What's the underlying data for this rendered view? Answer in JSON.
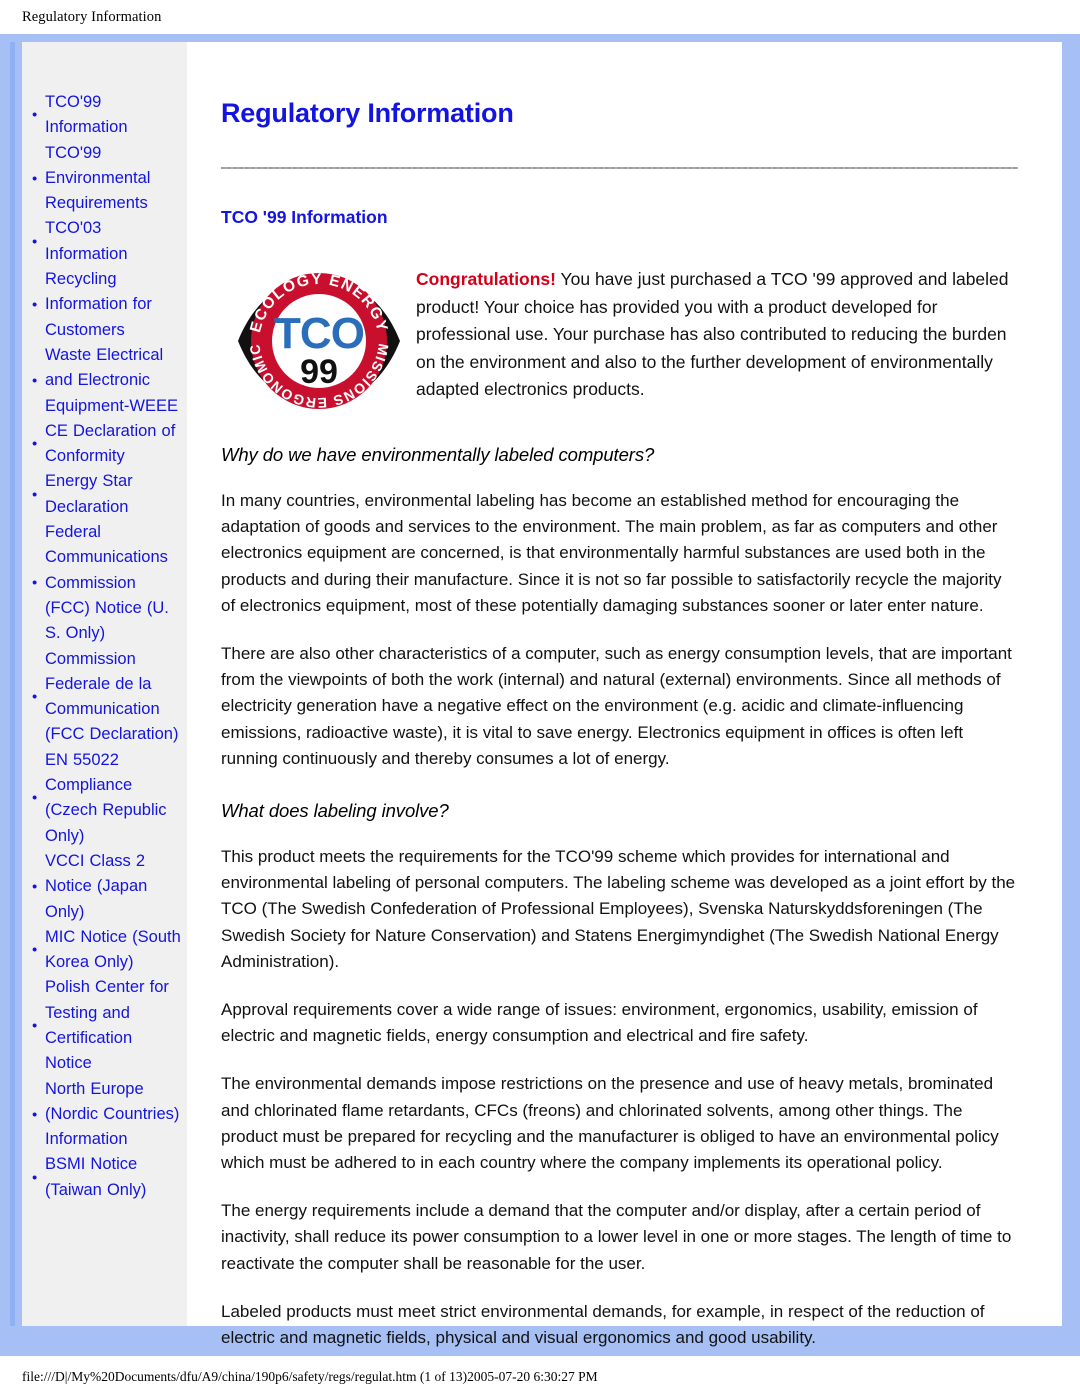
{
  "browser": {
    "header_title": "Regulatory Information",
    "footer_path": "file:///D|/My%20Documents/dfu/A9/china/190p6/safety/regs/regulat.htm (1 of 13)2005-07-20 6:30:27 PM"
  },
  "colors": {
    "frame_blue": "#a6c0f5",
    "link_blue": "#1414e0",
    "sidebar_gray": "#f0f0f0",
    "congrats_red": "#d4001a",
    "logo_red": "#c8102e",
    "logo_tco_blue": "#2a6ebb"
  },
  "sidebar": {
    "items": [
      {
        "label": "TCO'99 Information"
      },
      {
        "label": "TCO'99 Environmental Requirements"
      },
      {
        "label": "TCO'03 Information"
      },
      {
        "label": "Recycling Information for Customers"
      },
      {
        "label": "Waste Electrical and Electronic Equipment-WEEE"
      },
      {
        "label": "CE Declaration of Conformity"
      },
      {
        "label": "Energy Star Declaration"
      },
      {
        "label": "Federal Communications Commission (FCC) Notice (U. S. Only)"
      },
      {
        "label": "Commission Federale de la Communication (FCC Declaration)"
      },
      {
        "label": "EN 55022 Compliance (Czech Republic Only)"
      },
      {
        "label": "VCCI Class 2 Notice (Japan Only)"
      },
      {
        "label": "MIC Notice (South Korea Only)"
      },
      {
        "label": "Polish Center for Testing and Certification Notice"
      },
      {
        "label": "North Europe (Nordic Countries) Information"
      },
      {
        "label": "BSMI Notice (Taiwan Only)"
      }
    ]
  },
  "main": {
    "page_title": "Regulatory Information",
    "section_title": "TCO '99 Information",
    "logo": {
      "name": "tco-99-certification-logo",
      "top_arc_text": "ECOLOGY  ENERGY",
      "bottom_arc_text": "EMISSIONS  ERGONOMICS",
      "center_brand": "TCO",
      "center_year": "99"
    },
    "intro": {
      "lead": "Congratulations!",
      "body": " You have just purchased a TCO '99 approved and labeled product! Your choice has provided you with a product developed for professional use. Your purchase has also contributed to reducing the burden on the environment and also to the further development of environmentally adapted electronics products."
    },
    "heading_why": "Why do we have environmentally labeled computers?",
    "paragraph_1": "In many countries, environmental labeling has become an established method for encouraging the adaptation of goods and services to the environment. The main problem, as far as computers and other electronics equipment are concerned, is that environmentally harmful substances are used both in the products and during their manufacture. Since it is not so far possible to satisfactorily recycle the majority of electronics equipment, most of these potentially damaging substances sooner or later enter nature.",
    "paragraph_2": "There are also other characteristics of a computer, such as energy consumption levels, that are important from the viewpoints of both the work (internal) and natural (external) environments. Since all methods of electricity generation have a negative effect on the environment (e.g. acidic and climate-influencing emissions, radioactive waste), it is vital to save energy. Electronics equipment in offices is often left running continuously and thereby consumes a lot of energy.",
    "heading_what": "What does labeling involve?",
    "paragraph_3": "This product meets the requirements for the TCO'99 scheme which provides for international and environmental labeling of personal computers. The labeling scheme was developed as a joint effort by the TCO (The Swedish Confederation of Professional Employees), Svenska Naturskyddsforeningen (The Swedish Society for Nature Conservation) and Statens Energimyndighet (The Swedish National Energy Administration).",
    "paragraph_4": "Approval requirements cover a wide range of issues: environment, ergonomics, usability, emission of electric and magnetic fields, energy consumption and electrical and fire safety.",
    "paragraph_5": "The environmental demands impose restrictions on the presence and use of heavy metals, brominated and chlorinated flame retardants, CFCs (freons) and chlorinated solvents, among other things. The product must be prepared for recycling and the manufacturer is obliged to have an environmental policy which must be adhered to in each country where the company implements its operational policy.",
    "paragraph_6": "The energy requirements include a demand that the computer and/or display, after a certain period of inactivity, shall reduce its power consumption to a lower level in one or more stages. The length of time to reactivate the computer shall be reasonable for the user.",
    "paragraph_7": "Labeled products must meet strict environmental demands, for example, in respect of the reduction of electric and magnetic fields, physical and visual ergonomics and good usability."
  }
}
